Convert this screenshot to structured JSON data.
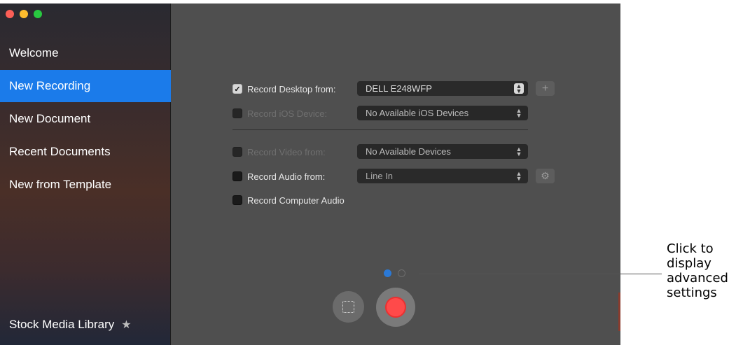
{
  "window_controls": [
    "close",
    "minimize",
    "maximize"
  ],
  "sidebar": {
    "items": [
      {
        "label": "Welcome"
      },
      {
        "label": "New Recording",
        "selected": true
      },
      {
        "label": "New Document"
      },
      {
        "label": "Recent Documents"
      },
      {
        "label": "New from Template"
      }
    ],
    "footer": {
      "label": "Stock Media Library",
      "icon": "star-icon"
    }
  },
  "recording": {
    "desktop": {
      "label": "Record Desktop from:",
      "checked": true,
      "enabled": true,
      "value": "DELL E248WFP",
      "extra_button": "+"
    },
    "ios": {
      "label": "Record iOS Device:",
      "checked": false,
      "enabled": false,
      "value": "No Available iOS Devices"
    },
    "video": {
      "label": "Record Video from:",
      "checked": false,
      "enabled": false,
      "value": "No Available Devices"
    },
    "audio": {
      "label": "Record Audio from:",
      "checked": false,
      "enabled": true,
      "value": "Line In",
      "extra_button": "gear-icon"
    },
    "computer_audio": {
      "label": "Record Computer Audio",
      "checked": false
    }
  },
  "pager": {
    "pages": 2,
    "current": 1
  },
  "callout": {
    "text_lines": [
      "Click to",
      "display",
      "advanced",
      "settings"
    ]
  },
  "colors": {
    "accent": "#1b7bea",
    "record": "#ff4a4a",
    "page_dot_active": "#2b79d6"
  }
}
